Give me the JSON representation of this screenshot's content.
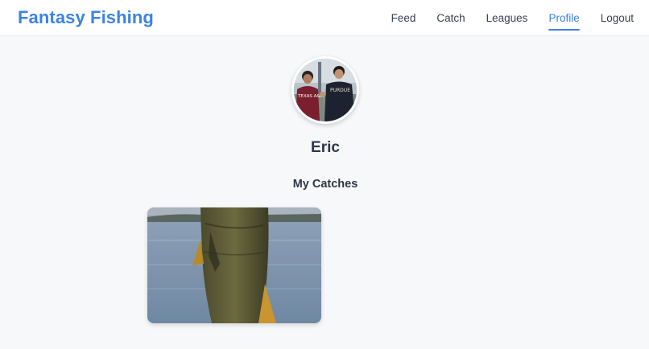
{
  "app": {
    "brand": "Fantasy Fishing"
  },
  "nav": {
    "items": [
      {
        "label": "Feed",
        "active": false
      },
      {
        "label": "Catch",
        "active": false
      },
      {
        "label": "Leagues",
        "active": false
      },
      {
        "label": "Profile",
        "active": true
      },
      {
        "label": "Logout",
        "active": false
      }
    ]
  },
  "profile": {
    "username": "Eric",
    "avatar_icon": "profile-photo",
    "section_title": "My Catches"
  },
  "catches": [
    {
      "image": "bass-catch-photo"
    }
  ],
  "colors": {
    "accent": "#3b82e6",
    "text": "#2d3748",
    "background": "#f7f8fa"
  }
}
